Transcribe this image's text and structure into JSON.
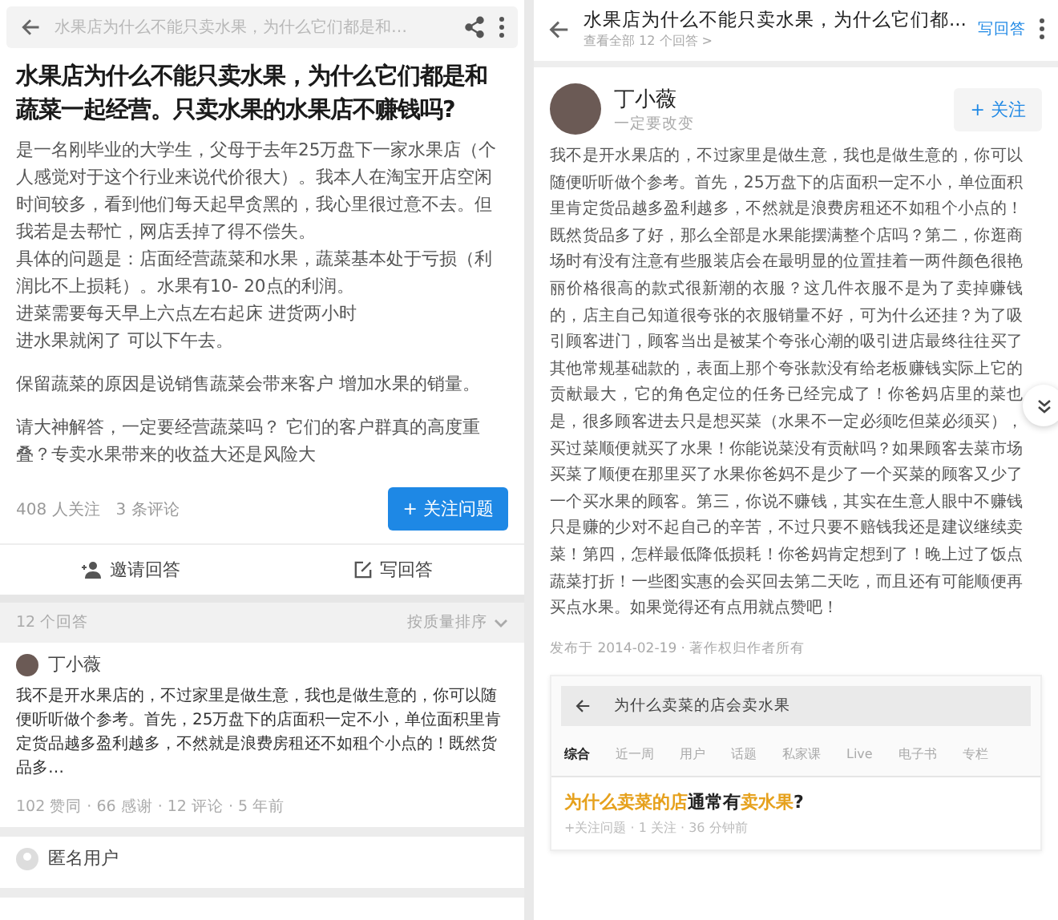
{
  "question_page": {
    "top_bar": {
      "title": "水果店为什么不能只卖水果，为什么它们都是和…"
    },
    "title": "水果店为什么不能只卖水果，为什么它们都是和蔬菜一起经营。只卖水果的水果店不赚钱吗?",
    "paragraphs": [
      [
        "是一名刚毕业的大学生，父母于去年25万盘下一家水果店（个人感觉对于这个行业来说代价很大）。我本人在淘宝开店空闲时间较多，看到他们每天起早贪黑的，我心里很过意不去。但我若是去帮忙，网店丢掉了得不偿失。",
        "具体的问题是：店面经营蔬菜和水果，蔬菜基本处于亏损（利润比不上损耗）。水果有10- 20点的利润。",
        "进菜需要每天早上六点左右起床 进货两小时",
        "进水果就闲了 可以下午去。"
      ],
      [
        "保留蔬菜的原因是说销售蔬菜会带来客户 增加水果的销量。"
      ],
      [
        "请大神解答，一定要经营蔬菜吗？ 它们的客户群真的高度重叠？专卖水果带来的收益大还是风险大"
      ]
    ],
    "followers": "408 人关注",
    "comments": "3 条评论",
    "follow_button": "+ 关注问题",
    "actions": [
      {
        "kind": "invite",
        "label": "邀请回答"
      },
      {
        "kind": "write",
        "label": "写回答"
      }
    ],
    "answers_count": "12 个回答",
    "sort": "按质量排序",
    "answers": [
      {
        "kind": "photo",
        "author": "丁小薇",
        "text": "我不是开水果店的，不过家里是做生意，我也是做生意的，你可以随便听听做个参考。首先，25万盘下的店面积一定不小，单位面积里肯定货品越多盈利越多，不然就是浪费房租还不如租个小点的！既然货品多…",
        "meta": "102 赞同 · 66 感谢 · 12 评论 · 5 年前"
      },
      {
        "kind": "anonymous",
        "author": "匿名用户"
      }
    ]
  },
  "answer_page": {
    "header": {
      "title": "水果店为什么不能只卖水果，为什么它们都...",
      "subtitle": "查看全部 12 个回答 >",
      "write_button": "写回答"
    },
    "author": {
      "name": "丁小薇",
      "bio": "一定要改变",
      "follow_button": "+ 关注"
    },
    "body": "我不是开水果店的，不过家里是做生意，我也是做生意的，你可以随便听听做个参考。首先，25万盘下的店面积一定不小，单位面积里肯定货品越多盈利越多，不然就是浪费房租还不如租个小点的！既然货品多了好，那么全部是水果能摆满整个店吗？第二，你逛商场时有没有注意有些服装店会在最明显的位置挂着一两件颜色很艳丽价格很高的款式很新潮的衣服？这几件衣服不是为了卖掉赚钱的，店主自己知道很夸张的衣服销量不好，可为什么还挂？为了吸引顾客进门，顾客当出是被某个夸张心潮的吸引进店最终往往买了其他常规基础款的，表面上那个夸张款没有给老板赚钱实际上它的贡献最大，它的角色定位的任务已经完成了！你爸妈店里的菜也是，很多顾客进去只是想买菜（水果不一定必须吃但菜必须买），买过菜顺便就买了水果！你能说菜没有贡献吗？如果顾客去菜市场买菜了顺便在那里买了水果你爸妈不是少了一个买菜的顾客又少了一个买水果的顾客。第三，你说不赚钱，其实在生意人眼中不赚钱只是赚的少对不起自己的辛苦，不过只要不赔钱我还是建议继续卖菜！第四，怎样最低降低损耗！你爸妈肯定想到了！晚上过了饭点蔬菜打折！一些图实惠的会买回去第二天吃，而且还有可能顺便再买点水果。如果觉得还有点用就点赞吧！",
    "published": "发布于 2014-02-19 · 著作权归作者所有",
    "embedded_search": {
      "query": "为什么卖菜的店会卖水果",
      "tabs": [
        {
          "label": "综合",
          "selected": true
        },
        {
          "label": "近一周",
          "selected": false
        },
        {
          "label": "用户",
          "selected": false
        },
        {
          "label": "话题",
          "selected": false
        },
        {
          "label": "私家课",
          "selected": false
        },
        {
          "label": "Live",
          "selected": false
        },
        {
          "label": "电子书",
          "selected": false
        },
        {
          "label": "专栏",
          "selected": false
        }
      ],
      "result": {
        "title_parts": [
          {
            "text": "为什么卖菜的店",
            "highlight": true
          },
          {
            "text": "通常有",
            "highlight": false
          },
          {
            "text": "卖水果",
            "highlight": true
          },
          {
            "text": "?",
            "highlight": false
          }
        ],
        "meta": "+关注问题 · 1 关注 · 36 分钟前"
      }
    }
  }
}
